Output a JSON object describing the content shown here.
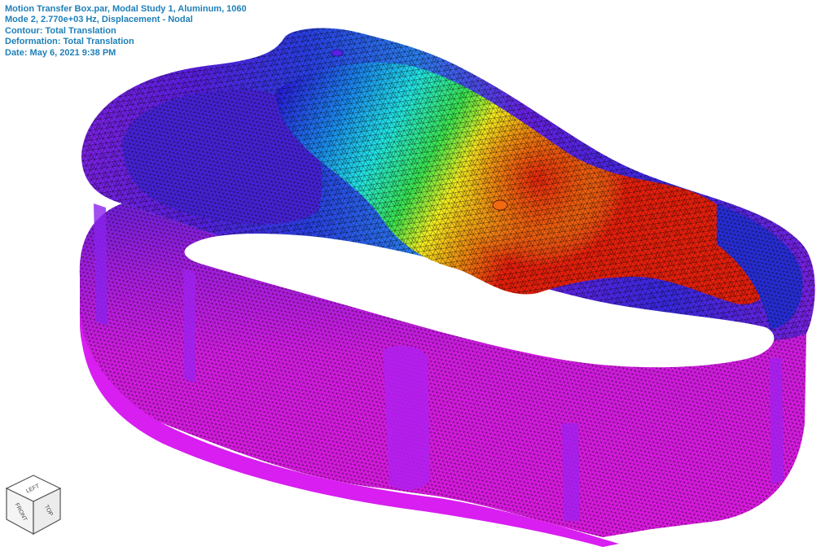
{
  "info": {
    "line1": "Motion Transfer Box.par, Modal Study 1, Aluminum, 1060",
    "line2": "Mode 2, 2.770e+03 Hz, Displacement - Nodal",
    "line3": "Contour: Total Translation",
    "line4": "Deformation: Total Translation",
    "line5": "Date: May 6, 2021  9:38 PM"
  },
  "viewcube": {
    "top_label": "TOP",
    "left_label": "LEFT",
    "front_label": "FRONT"
  },
  "colors": {
    "info_text": "#1e7fb8",
    "contour_low": "#e61cf0",
    "contour_mid_low": "#2a20e0",
    "contour_mid": "#22e6e6",
    "contour_mid_high": "#f4f020",
    "contour_high": "#e8200c",
    "mesh_lines": "#000000",
    "background": "#ffffff"
  },
  "icons": {
    "viewcube": "orientation-cube-icon"
  }
}
